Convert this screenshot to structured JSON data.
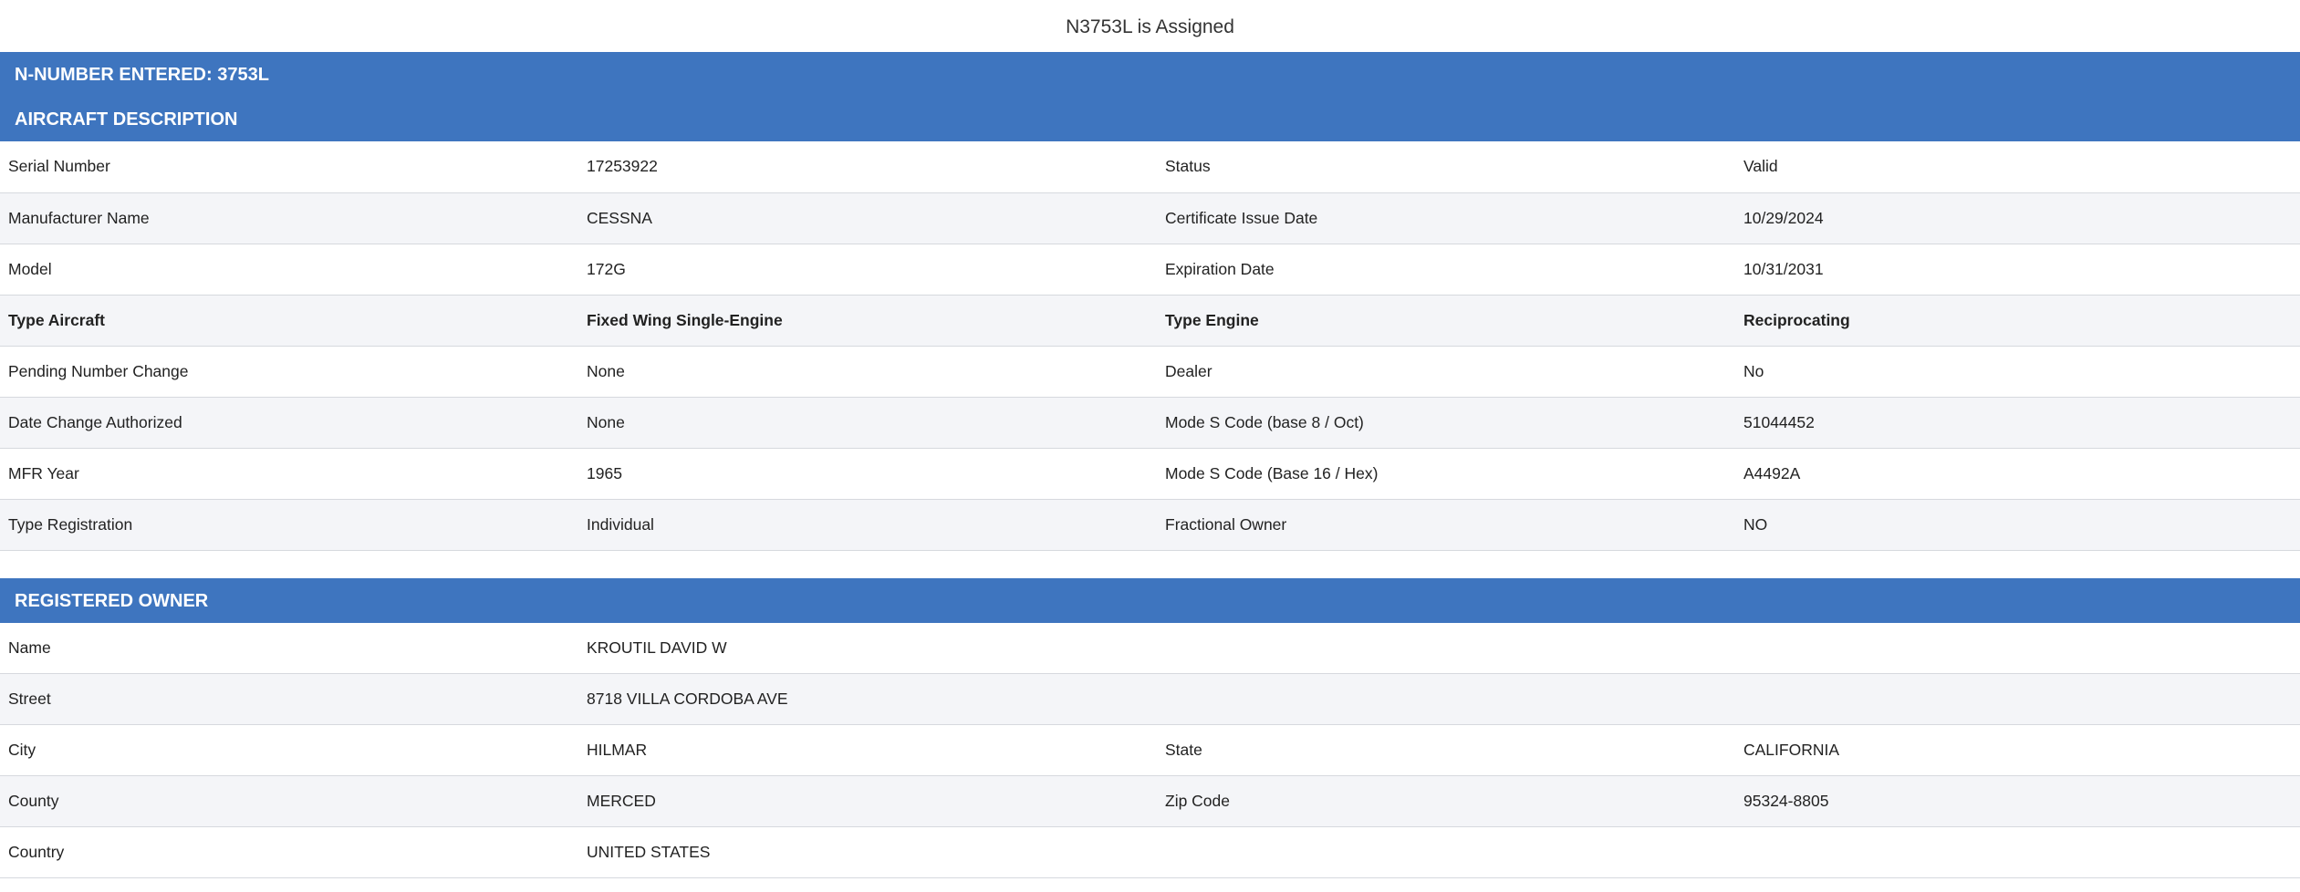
{
  "page_title": "N3753L is Assigned",
  "nnumber_banner": "N-NUMBER ENTERED: 3753L",
  "aircraft": {
    "heading": "AIRCRAFT DESCRIPTION",
    "rows": [
      [
        "Serial Number",
        "17253922",
        "Status",
        "Valid"
      ],
      [
        "Manufacturer Name",
        "CESSNA",
        "Certificate Issue Date",
        "10/29/2024"
      ],
      [
        "Model",
        "172G",
        "Expiration Date",
        "10/31/2031"
      ],
      [
        "Type Aircraft",
        "Fixed Wing Single-Engine",
        "Type Engine",
        "Reciprocating"
      ],
      [
        "Pending Number Change",
        "None",
        "Dealer",
        "No"
      ],
      [
        "Date Change Authorized",
        "None",
        "Mode S Code (base 8 / Oct)",
        "51044452"
      ],
      [
        "MFR Year",
        "1965",
        "Mode S Code (Base 16 / Hex)",
        "A4492A"
      ],
      [
        "Type Registration",
        "Individual",
        "Fractional Owner",
        "NO"
      ]
    ]
  },
  "owner": {
    "heading": "REGISTERED OWNER",
    "rows": [
      [
        "Name",
        "KROUTIL DAVID W",
        "",
        ""
      ],
      [
        "Street",
        "8718 VILLA CORDOBA AVE",
        "",
        ""
      ],
      [
        "City",
        "HILMAR",
        "State",
        "CALIFORNIA"
      ],
      [
        "County",
        "MERCED",
        "Zip Code",
        "95324-8805"
      ],
      [
        "Country",
        "UNITED STATES",
        "",
        ""
      ]
    ]
  }
}
